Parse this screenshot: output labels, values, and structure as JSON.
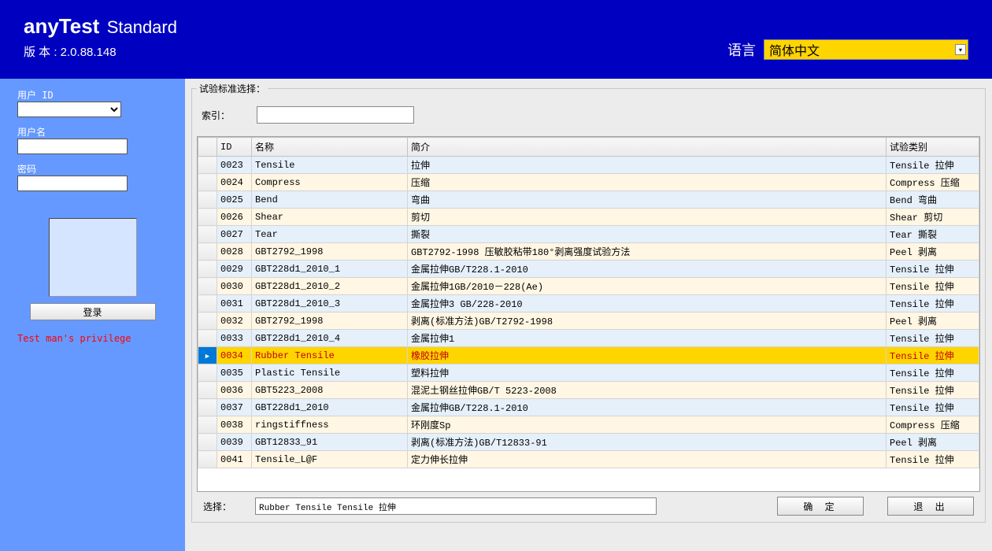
{
  "header": {
    "title": "anyTest",
    "subtitle": "Standard",
    "version_label": "版 本 : 2.0.88.148",
    "language_label": "语言",
    "language_value": "简体中文"
  },
  "sidebar": {
    "user_id_label": "用户 ID",
    "user_id_value": "",
    "user_name_label": "用户名",
    "user_name_value": "",
    "password_label": "密码",
    "password_value": "",
    "login_button": "登录",
    "privilege_text": "Test man's privilege"
  },
  "content": {
    "fieldset_legend": "试验标准选择：",
    "search_label": "索引：",
    "search_value": "",
    "columns": {
      "id": "ID",
      "name": "名称",
      "desc": "简介",
      "cat": "试验类别"
    },
    "rows": [
      {
        "id": "0023",
        "name": "Tensile",
        "desc": "拉伸",
        "cat": "Tensile 拉伸"
      },
      {
        "id": "0024",
        "name": "Compress",
        "desc": "压缩",
        "cat": "Compress 压缩"
      },
      {
        "id": "0025",
        "name": "Bend",
        "desc": "弯曲",
        "cat": "Bend 弯曲"
      },
      {
        "id": "0026",
        "name": "Shear",
        "desc": "剪切",
        "cat": "Shear 剪切"
      },
      {
        "id": "0027",
        "name": "Tear",
        "desc": "撕裂",
        "cat": "Tear 撕裂"
      },
      {
        "id": "0028",
        "name": "GBT2792_1998",
        "desc": "GBT2792-1998 压敏胶粘带180°剥离强度试验方法",
        "cat": "Peel 剥离"
      },
      {
        "id": "0029",
        "name": "GBT228d1_2010_1",
        "desc": "金属拉伸GB/T228.1-2010",
        "cat": "Tensile 拉伸"
      },
      {
        "id": "0030",
        "name": "GBT228d1_2010_2",
        "desc": "金属拉伸1GB/2010－228(Ae)",
        "cat": "Tensile 拉伸"
      },
      {
        "id": "0031",
        "name": "GBT228d1_2010_3",
        "desc": "金属拉伸3 GB/228-2010",
        "cat": "Tensile 拉伸"
      },
      {
        "id": "0032",
        "name": "GBT2792_1998",
        "desc": "剥离(标准方法)GB/T2792-1998",
        "cat": "Peel 剥离"
      },
      {
        "id": "0033",
        "name": "GBT228d1_2010_4",
        "desc": "金属拉伸1",
        "cat": "Tensile 拉伸"
      },
      {
        "id": "0034",
        "name": "Rubber Tensile",
        "desc": "橡胶拉伸",
        "cat": "Tensile 拉伸",
        "selected": true
      },
      {
        "id": "0035",
        "name": "Plastic Tensile",
        "desc": "塑料拉伸",
        "cat": "Tensile 拉伸"
      },
      {
        "id": "0036",
        "name": "GBT5223_2008",
        "desc": "混泥土钢丝拉伸GB/T 5223-2008",
        "cat": "Tensile 拉伸"
      },
      {
        "id": "0037",
        "name": "GBT228d1_2010",
        "desc": "金属拉伸GB/T228.1-2010",
        "cat": "Tensile 拉伸"
      },
      {
        "id": "0038",
        "name": "ringstiffness",
        "desc": "环刚度Sp",
        "cat": "Compress 压缩"
      },
      {
        "id": "0039",
        "name": "GBT12833_91",
        "desc": "剥离(标准方法)GB/T12833-91",
        "cat": "Peel 剥离"
      },
      {
        "id": "0041",
        "name": "Tensile_L@F",
        "desc": "定力伸长拉伸",
        "cat": "Tensile 拉伸"
      }
    ],
    "selection_label": "选择：",
    "selection_value": "Rubber Tensile   Tensile 拉伸",
    "ok_button": "确 定",
    "exit_button": "退 出",
    "row_marker": "▶"
  }
}
